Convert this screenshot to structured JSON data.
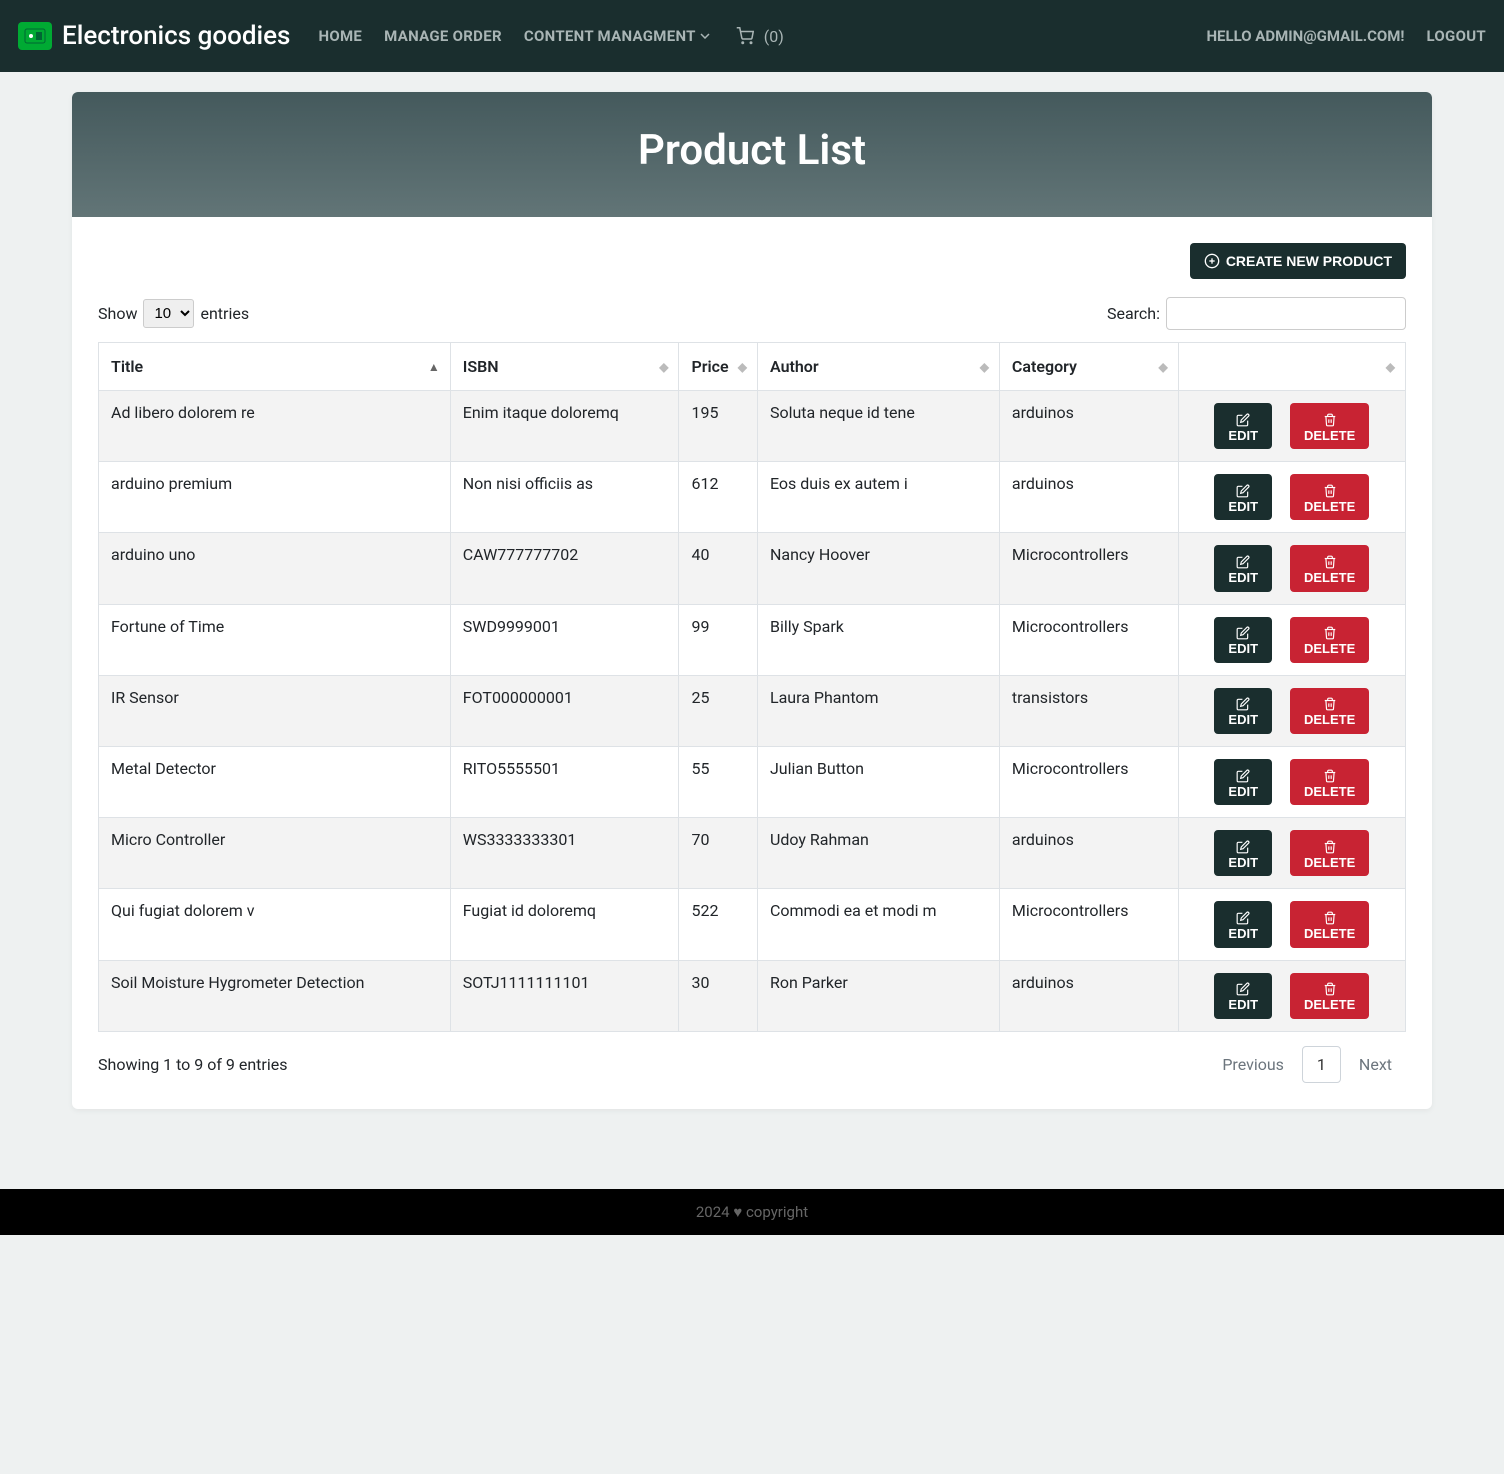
{
  "nav": {
    "brand": "Electronics goodies",
    "links": {
      "home": "HOME",
      "manage": "MANAGE ORDER",
      "content": "CONTENT MANAGMENT"
    },
    "cart_count": "(0)",
    "greet": "HELLO ADMIN@GMAIL.COM!",
    "logout": "LOGOUT"
  },
  "page": {
    "title": "Product List"
  },
  "actions": {
    "create": "CREATE NEW PRODUCT",
    "edit": "EDIT",
    "delete": "DELETE"
  },
  "table_ctrl": {
    "show": "Show",
    "entries": "entries",
    "length_val": "10",
    "search_label": "Search:"
  },
  "columns": [
    "Title",
    "ISBN",
    "Price",
    "Author",
    "Category",
    ""
  ],
  "rows": [
    {
      "title": "Ad libero dolorem re",
      "isbn": "Enim itaque doloremq",
      "price": "195",
      "author": "Soluta neque id tene",
      "category": "arduinos"
    },
    {
      "title": "arduino premium",
      "isbn": "Non nisi officiis as",
      "price": "612",
      "author": "Eos duis ex autem i",
      "category": "arduinos"
    },
    {
      "title": "arduino uno",
      "isbn": "CAW777777702",
      "price": "40",
      "author": "Nancy Hoover",
      "category": "Microcontrollers"
    },
    {
      "title": "Fortune of Time",
      "isbn": "SWD9999001",
      "price": "99",
      "author": "Billy Spark",
      "category": "Microcontrollers"
    },
    {
      "title": "IR Sensor",
      "isbn": "FOT000000001",
      "price": "25",
      "author": "Laura Phantom",
      "category": "transistors"
    },
    {
      "title": "Metal Detector",
      "isbn": "RITO5555501",
      "price": "55",
      "author": "Julian Button",
      "category": "Microcontrollers"
    },
    {
      "title": "Micro Controller",
      "isbn": "WS3333333301",
      "price": "70",
      "author": "Udoy Rahman",
      "category": "arduinos"
    },
    {
      "title": "Qui fugiat dolorem v",
      "isbn": "Fugiat id doloremq",
      "price": "522",
      "author": "Commodi ea et modi m",
      "category": "Microcontrollers"
    },
    {
      "title": "Soil Moisture Hygrometer Detection",
      "isbn": "SOTJ1111111101",
      "price": "30",
      "author": "Ron Parker",
      "category": "arduinos"
    }
  ],
  "footer": {
    "info": "Showing 1 to 9 of 9 entries",
    "prev": "Previous",
    "page": "1",
    "next": "Next"
  },
  "site_footer": "2024 ♥ copyright"
}
